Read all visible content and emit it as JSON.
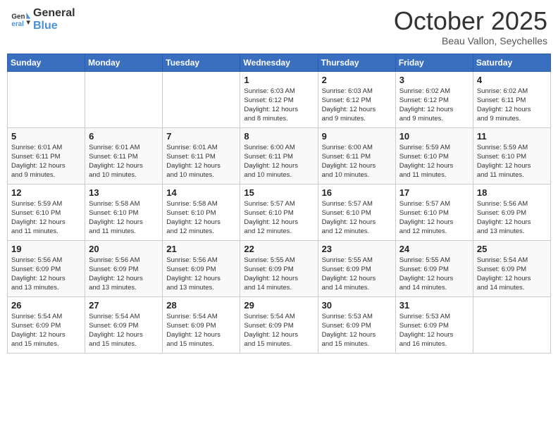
{
  "logo": {
    "line1": "General",
    "line2": "Blue"
  },
  "title": "October 2025",
  "subtitle": "Beau Vallon, Seychelles",
  "weekdays": [
    "Sunday",
    "Monday",
    "Tuesday",
    "Wednesday",
    "Thursday",
    "Friday",
    "Saturday"
  ],
  "weeks": [
    [
      {
        "day": "",
        "info": ""
      },
      {
        "day": "",
        "info": ""
      },
      {
        "day": "",
        "info": ""
      },
      {
        "day": "1",
        "info": "Sunrise: 6:03 AM\nSunset: 6:12 PM\nDaylight: 12 hours\nand 8 minutes."
      },
      {
        "day": "2",
        "info": "Sunrise: 6:03 AM\nSunset: 6:12 PM\nDaylight: 12 hours\nand 9 minutes."
      },
      {
        "day": "3",
        "info": "Sunrise: 6:02 AM\nSunset: 6:12 PM\nDaylight: 12 hours\nand 9 minutes."
      },
      {
        "day": "4",
        "info": "Sunrise: 6:02 AM\nSunset: 6:11 PM\nDaylight: 12 hours\nand 9 minutes."
      }
    ],
    [
      {
        "day": "5",
        "info": "Sunrise: 6:01 AM\nSunset: 6:11 PM\nDaylight: 12 hours\nand 9 minutes."
      },
      {
        "day": "6",
        "info": "Sunrise: 6:01 AM\nSunset: 6:11 PM\nDaylight: 12 hours\nand 10 minutes."
      },
      {
        "day": "7",
        "info": "Sunrise: 6:01 AM\nSunset: 6:11 PM\nDaylight: 12 hours\nand 10 minutes."
      },
      {
        "day": "8",
        "info": "Sunrise: 6:00 AM\nSunset: 6:11 PM\nDaylight: 12 hours\nand 10 minutes."
      },
      {
        "day": "9",
        "info": "Sunrise: 6:00 AM\nSunset: 6:11 PM\nDaylight: 12 hours\nand 10 minutes."
      },
      {
        "day": "10",
        "info": "Sunrise: 5:59 AM\nSunset: 6:10 PM\nDaylight: 12 hours\nand 11 minutes."
      },
      {
        "day": "11",
        "info": "Sunrise: 5:59 AM\nSunset: 6:10 PM\nDaylight: 12 hours\nand 11 minutes."
      }
    ],
    [
      {
        "day": "12",
        "info": "Sunrise: 5:59 AM\nSunset: 6:10 PM\nDaylight: 12 hours\nand 11 minutes."
      },
      {
        "day": "13",
        "info": "Sunrise: 5:58 AM\nSunset: 6:10 PM\nDaylight: 12 hours\nand 11 minutes."
      },
      {
        "day": "14",
        "info": "Sunrise: 5:58 AM\nSunset: 6:10 PM\nDaylight: 12 hours\nand 12 minutes."
      },
      {
        "day": "15",
        "info": "Sunrise: 5:57 AM\nSunset: 6:10 PM\nDaylight: 12 hours\nand 12 minutes."
      },
      {
        "day": "16",
        "info": "Sunrise: 5:57 AM\nSunset: 6:10 PM\nDaylight: 12 hours\nand 12 minutes."
      },
      {
        "day": "17",
        "info": "Sunrise: 5:57 AM\nSunset: 6:10 PM\nDaylight: 12 hours\nand 12 minutes."
      },
      {
        "day": "18",
        "info": "Sunrise: 5:56 AM\nSunset: 6:09 PM\nDaylight: 12 hours\nand 13 minutes."
      }
    ],
    [
      {
        "day": "19",
        "info": "Sunrise: 5:56 AM\nSunset: 6:09 PM\nDaylight: 12 hours\nand 13 minutes."
      },
      {
        "day": "20",
        "info": "Sunrise: 5:56 AM\nSunset: 6:09 PM\nDaylight: 12 hours\nand 13 minutes."
      },
      {
        "day": "21",
        "info": "Sunrise: 5:56 AM\nSunset: 6:09 PM\nDaylight: 12 hours\nand 13 minutes."
      },
      {
        "day": "22",
        "info": "Sunrise: 5:55 AM\nSunset: 6:09 PM\nDaylight: 12 hours\nand 14 minutes."
      },
      {
        "day": "23",
        "info": "Sunrise: 5:55 AM\nSunset: 6:09 PM\nDaylight: 12 hours\nand 14 minutes."
      },
      {
        "day": "24",
        "info": "Sunrise: 5:55 AM\nSunset: 6:09 PM\nDaylight: 12 hours\nand 14 minutes."
      },
      {
        "day": "25",
        "info": "Sunrise: 5:54 AM\nSunset: 6:09 PM\nDaylight: 12 hours\nand 14 minutes."
      }
    ],
    [
      {
        "day": "26",
        "info": "Sunrise: 5:54 AM\nSunset: 6:09 PM\nDaylight: 12 hours\nand 15 minutes."
      },
      {
        "day": "27",
        "info": "Sunrise: 5:54 AM\nSunset: 6:09 PM\nDaylight: 12 hours\nand 15 minutes."
      },
      {
        "day": "28",
        "info": "Sunrise: 5:54 AM\nSunset: 6:09 PM\nDaylight: 12 hours\nand 15 minutes."
      },
      {
        "day": "29",
        "info": "Sunrise: 5:54 AM\nSunset: 6:09 PM\nDaylight: 12 hours\nand 15 minutes."
      },
      {
        "day": "30",
        "info": "Sunrise: 5:53 AM\nSunset: 6:09 PM\nDaylight: 12 hours\nand 15 minutes."
      },
      {
        "day": "31",
        "info": "Sunrise: 5:53 AM\nSunset: 6:09 PM\nDaylight: 12 hours\nand 16 minutes."
      },
      {
        "day": "",
        "info": ""
      }
    ]
  ]
}
